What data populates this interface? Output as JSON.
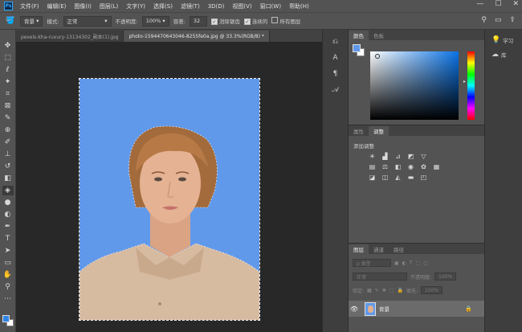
{
  "app": {
    "logo": "Ps"
  },
  "menu": [
    "文件(F)",
    "编辑(E)",
    "图像(I)",
    "图层(L)",
    "文字(Y)",
    "选择(S)",
    "滤镜(T)",
    "3D(D)",
    "视图(V)",
    "窗口(W)",
    "帮助(H)"
  ],
  "window_controls": [
    "—",
    "☐",
    "✕"
  ],
  "options": {
    "sample": "背景",
    "mode_label": "模式:",
    "mode_value": "正常",
    "opacity_label": "不透明度:",
    "opacity_value": "100%",
    "tolerance_label": "容差:",
    "tolerance_value": "32",
    "antialias_label": "消除锯齿",
    "contiguous_label": "连续的",
    "all_layers_label": "所有图层"
  },
  "tabs": [
    {
      "label": "pexels-kha-ruxury-13134302_副本(1).jpg",
      "active": false
    },
    {
      "label": "photo-1594470643046-8255fe0a.jpg @ 33.3%(RGB/8) *",
      "active": true
    }
  ],
  "colors": {
    "accent_blue": "#6199ea",
    "canvas_dark": "#282828",
    "panel": "#535353"
  },
  "color_panel": {
    "tabs": [
      "颜色",
      "色板"
    ]
  },
  "adjust_panel": {
    "tabs": [
      "属性",
      "调整"
    ],
    "title": "添加调整"
  },
  "layers_panel": {
    "tabs": [
      "图层",
      "通道",
      "路径"
    ],
    "kind_placeholder": "ρ 类型",
    "blend": "正常",
    "opacity_label": "不透明度:",
    "opacity_value": "100%",
    "lock_label": "锁定:",
    "fill_label": "填充:",
    "fill_value": "100%",
    "layer_name": "背景"
  },
  "side_panel": [
    {
      "icon": "lightbulb-icon",
      "label": "学习"
    },
    {
      "icon": "library-icon",
      "label": "库"
    }
  ]
}
